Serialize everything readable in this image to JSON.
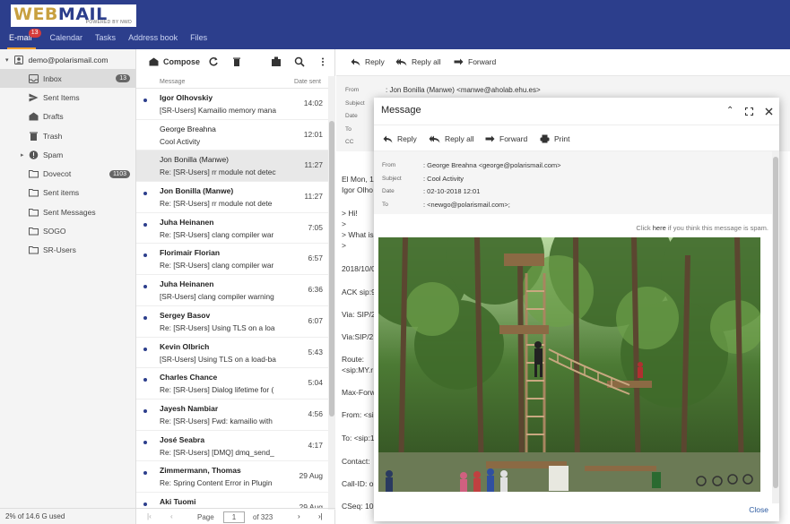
{
  "brand": {
    "logo_web": "WEB",
    "logo_mail": "MAIL",
    "logo_sub": "POWERED BY NWD"
  },
  "topnav": [
    {
      "label": "E-mail",
      "badge": "13"
    },
    {
      "label": "Calendar"
    },
    {
      "label": "Tasks"
    },
    {
      "label": "Address book"
    },
    {
      "label": "Files"
    }
  ],
  "sidebar": {
    "account": "demo@polarismail.com",
    "folders": [
      {
        "label": "Inbox",
        "count": "13",
        "icon": "inbox-icon"
      },
      {
        "label": "Sent Items",
        "icon": "send-icon"
      },
      {
        "label": "Drafts",
        "icon": "drafts-icon"
      },
      {
        "label": "Trash",
        "icon": "trash-icon"
      },
      {
        "label": "Spam",
        "icon": "spam-icon"
      },
      {
        "label": "Dovecot",
        "count": "1103",
        "icon": "folder-icon"
      },
      {
        "label": "Sent items",
        "icon": "folder-icon"
      },
      {
        "label": "Sent Messages",
        "icon": "folder-icon"
      },
      {
        "label": "SOGO",
        "icon": "folder-icon"
      },
      {
        "label": "SR-Users",
        "icon": "folder-icon"
      }
    ],
    "quota": "2% of 14.6 G used"
  },
  "list": {
    "compose": "Compose",
    "col_message": "Message",
    "col_date": "Date sent",
    "rows": [
      {
        "sender": "Igor Olhovskiy",
        "subject": "[SR-Users] Kamailio memory mana",
        "date": "14:02",
        "unread": true
      },
      {
        "sender": "George Breahna",
        "subject": "Cool Activity",
        "date": "12:01",
        "unread": false
      },
      {
        "sender": "Jon Bonilla (Manwe)",
        "subject": "Re: [SR-Users] rr module not detecti",
        "date": "11:27",
        "unread": false,
        "selected": true
      },
      {
        "sender": "Jon Bonilla (Manwe)",
        "subject": "Re: [SR-Users] rr module not dete",
        "date": "11:27",
        "unread": true
      },
      {
        "sender": "Juha Heinanen",
        "subject": "Re: [SR-Users] clang compiler war",
        "date": "7:05",
        "unread": true
      },
      {
        "sender": "Florimair Florian",
        "subject": "Re: [SR-Users] clang compiler war",
        "date": "6:57",
        "unread": true
      },
      {
        "sender": "Juha Heinanen",
        "subject": "[SR-Users] clang compiler warning",
        "date": "6:36",
        "unread": true
      },
      {
        "sender": "Sergey Basov",
        "subject": "Re: [SR-Users] Using TLS on a loa",
        "date": "6:07",
        "unread": true
      },
      {
        "sender": "Kevin Olbrich",
        "subject": "[SR-Users] Using TLS on a load-ba",
        "date": "5:43",
        "unread": true
      },
      {
        "sender": "Charles Chance",
        "subject": "Re: [SR-Users] Dialog lifetime for (",
        "date": "5:04",
        "unread": true
      },
      {
        "sender": "Jayesh Nambiar",
        "subject": "Re: [SR-Users] Fwd: kamailio with",
        "date": "4:56",
        "unread": true
      },
      {
        "sender": "José Seabra",
        "subject": "Re: [SR-Users] [DMQ] dmq_send_",
        "date": "4:17",
        "unread": true
      },
      {
        "sender": "Zimmermann, Thomas",
        "subject": "Re: Spring Content Error in Plugin",
        "date": "29 Aug",
        "unread": true
      },
      {
        "sender": "Aki Tuomi",
        "subject": "",
        "date": "29 Aug",
        "unread": true
      }
    ],
    "pager": {
      "page_label": "Page",
      "page": "1",
      "of": "of 323"
    }
  },
  "preview": {
    "reply": "Reply",
    "reply_all": "Reply all",
    "forward": "Forward",
    "headers": {
      "from_label": "From",
      "from": ": Jon Bonilla (Manwe) <manwe@aholab.ehu.es>",
      "subject_label": "Subject",
      "date_label": "Date",
      "to_label": "To",
      "cc_label": "CC"
    },
    "body": [
      "El Mon, 1",
      "Igor Olho",
      "> Hi!",
      ">",
      "> What is",
      ">",
      "2018/10/0",
      "ACK sip:9",
      "Via: SIP/2",
      "Via:SIP/2",
      "Route:",
      "<sip:MY.r",
      "Max-Forw",
      "From: <si",
      "To: <sip:1",
      "Contact:",
      "Call-ID: o",
      "CSeq: 10"
    ]
  },
  "modal": {
    "title": "Message",
    "reply": "Reply",
    "reply_all": "Reply all",
    "forward": "Forward",
    "print": "Print",
    "from_label": "From",
    "from": ": George Breahna <george@polarismail.com>",
    "subject_label": "Subject",
    "subject": ": Cool Activity",
    "date_label": "Date",
    "date": ": 02-10-2018 12:01",
    "to_label": "To",
    "to": ": <newgo@polarismail.com>;",
    "spam_pre": "Click ",
    "spam_here": "here",
    "spam_post": " if you think this message is spam.",
    "close": "Close"
  }
}
